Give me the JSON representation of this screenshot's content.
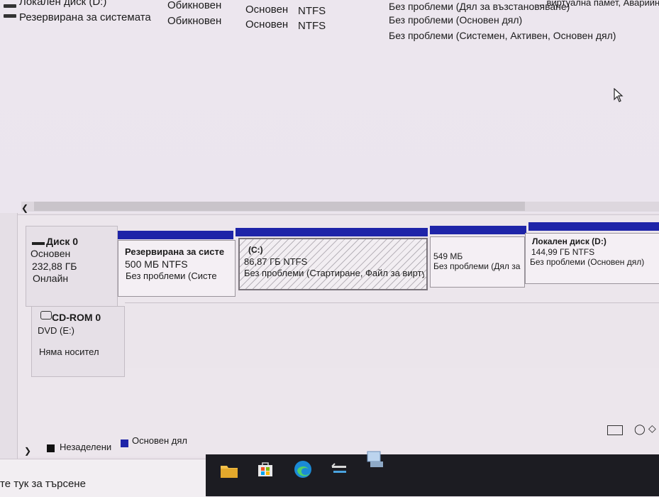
{
  "volumes": [
    {
      "name": "Локален диск (D:)",
      "layout": "Обикновен",
      "type": "Основен",
      "fs": "NTFS",
      "status": "Без проблеми (Дял за възстановяване)"
    },
    {
      "name": "Резервирана за системата",
      "layout": "Обикновен",
      "type": "Основен",
      "fs": "NTFS",
      "status": "Без проблеми (Основен дял)"
    },
    {
      "status": "Без проблеми (Системен, Активен, Основен дял)"
    }
  ],
  "top_right_cut": "... виртуална памет, Аварийно к",
  "disks": [
    {
      "title": "Диск 0",
      "kind": "Основен",
      "size": "232,88 ГБ",
      "state": "Онлайн",
      "partitions": [
        {
          "name": "Резервирана за систе",
          "size": "500 МБ NTFS",
          "status": "Без проблеми (Систе"
        },
        {
          "name": "(C:)",
          "size": "86,87 ГБ NTFS",
          "status": "Без проблеми (Стартиране, Файл за вирту"
        },
        {
          "name": "",
          "size": "549 МБ",
          "status": "Без проблеми (Дял за"
        },
        {
          "name": "Локален диск  (D:)",
          "size": "144,99 ГБ NTFS",
          "status": "Без проблеми (Основен дял)"
        }
      ]
    },
    {
      "title": "CD-ROM 0",
      "kind": "DVD (E:)",
      "state": "Няма носител"
    }
  ],
  "legend": {
    "unallocated": "Незаделени",
    "primary": "Основен дял",
    "unallocated_color": "#111111",
    "primary_color": "#1e24a8"
  },
  "search": {
    "placeholder": "те тук за търсене"
  },
  "taskbar_icons": [
    "folder-icon",
    "store-icon",
    "edge-icon",
    "network-icon",
    "disk-mgmt-icon"
  ]
}
